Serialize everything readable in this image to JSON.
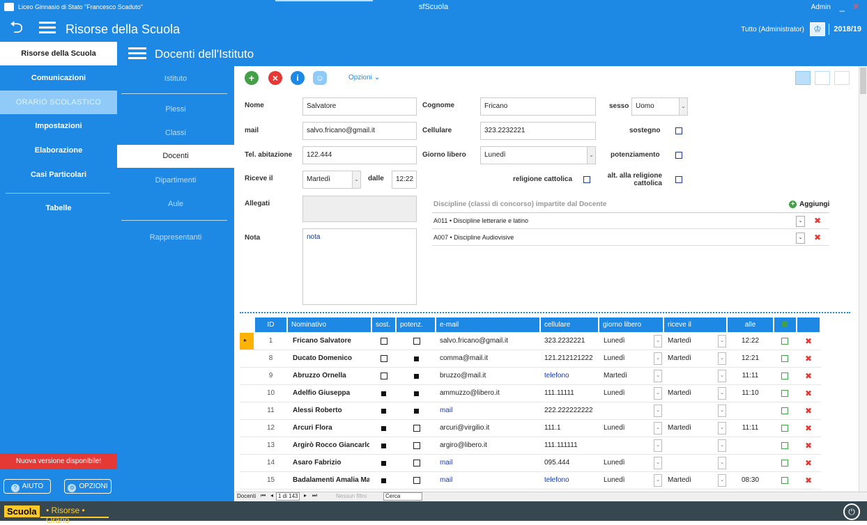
{
  "window": {
    "school": "Liceo Ginnasio di Stato \"Francesco Scaduto\"",
    "app_title": "sfScuola",
    "user": "Admin"
  },
  "header": {
    "title": "Risorse della Scuola",
    "user_label": "Tutto (Administrator)",
    "year": "2018/19"
  },
  "sidebar": {
    "items": [
      "Risorse della Scuola",
      "Comunicazioni",
      "ORARIO SCOLASTICO",
      "Impostazioni",
      "Elaborazione",
      "Casi Particolari",
      "Tabelle"
    ],
    "new_version": "Nuova versione disponibile!",
    "help": "AIUTO",
    "options": "OPZIONI"
  },
  "bottom": {
    "brand": "Scuola",
    "sub": "• Risorse • Orario"
  },
  "panel": {
    "title": "Docenti dell'Istituto"
  },
  "subnav": [
    "Istituto",
    "Plessi",
    "Classi",
    "Docenti",
    "Dipartimenti",
    "Aule",
    "Rappresentanti"
  ],
  "toolbar": {
    "options": "Opzioni"
  },
  "form": {
    "labels": {
      "nome": "Nome",
      "cognome": "Cognome",
      "sesso": "sesso",
      "mail": "mail",
      "cellulare": "Cellulare",
      "sostegno": "sostegno",
      "tel": "Tel. abitazione",
      "giorno": "Giorno libero",
      "potenziamento": "potenziamento",
      "riceve": "Riceve il",
      "dalle": "dalle",
      "religione": "religione cattolica",
      "alt1": "alt. alla religione",
      "alt2": "cattolica",
      "allegati": "Allegati",
      "nota": "Nota"
    },
    "values": {
      "nome": "Salvatore",
      "cognome": "Fricano",
      "sesso": "Uomo",
      "mail": "salvo.fricano@gmail.it",
      "cellulare": "323.2232221",
      "tel": "122.444",
      "giorno": "Lunedì",
      "riceve": "Martedì",
      "dalle": "12:22",
      "nota": "nota"
    },
    "disciplines_title": "Discipline (classi di concorso) impartite dal Docente",
    "add": "Aggiungi",
    "disciplines": [
      "A011 • Discipline letterarie e latino",
      "A007 • Discipline Audiovisive"
    ]
  },
  "table": {
    "headers": [
      "ID",
      "Nominativo",
      "sost.",
      "potenz.",
      "e-mail",
      "cellulare",
      "giorno libero",
      "riceve il",
      "alle"
    ],
    "rows": [
      {
        "id": "1",
        "name": "Fricano Salvatore",
        "sost": false,
        "pot": false,
        "email": "salvo.fricano@gmail.it",
        "cell": "323.2232221",
        "giorno": "Lunedì",
        "riceve": "Martedì",
        "alle": "12:22"
      },
      {
        "id": "8",
        "name": "Ducato Domenico",
        "sost": false,
        "pot": true,
        "email": "comma@mail.it",
        "cell": "121.212121222",
        "giorno": "Lunedì",
        "riceve": "Martedì",
        "alle": "12:21"
      },
      {
        "id": "9",
        "name": "Abruzzo Ornella",
        "sost": false,
        "pot": true,
        "email": "bruzzo@mail.it",
        "cell": "telefono",
        "giorno": "Martedì",
        "riceve": "",
        "alle": "11:11"
      },
      {
        "id": "10",
        "name": "Adelfio Giuseppa",
        "sost": true,
        "pot": true,
        "email": "ammuzzo@libero.it",
        "cell": "111.11111",
        "giorno": "Lunedì",
        "riceve": "Martedì",
        "alle": "11:10"
      },
      {
        "id": "11",
        "name": "Alessi Roberto",
        "sost": true,
        "pot": true,
        "email": "mail",
        "cell": "222.222222222",
        "giorno": "",
        "riceve": "",
        "alle": ""
      },
      {
        "id": "12",
        "name": "Arcuri Flora",
        "sost": true,
        "pot": false,
        "email": "arcuri@virgilio.it",
        "cell": "111.1",
        "giorno": "Lunedì",
        "riceve": "Martedì",
        "alle": "11:11"
      },
      {
        "id": "13",
        "name": "Argirò Rocco Giancarlo",
        "sost": true,
        "pot": false,
        "email": "argiro@libero.it",
        "cell": "111.111111",
        "giorno": "",
        "riceve": "",
        "alle": ""
      },
      {
        "id": "14",
        "name": "Asaro Fabrizio",
        "sost": true,
        "pot": false,
        "email": "mail",
        "cell": "095.444",
        "giorno": "Lunedì",
        "riceve": "",
        "alle": ""
      },
      {
        "id": "15",
        "name": "Badalamenti Amalia Ma",
        "sost": true,
        "pot": false,
        "email": "mail",
        "cell": "telefono",
        "giorno": "Lunedì",
        "riceve": "Martedì",
        "alle": "08:30"
      }
    ]
  },
  "navigator": {
    "label": "Docenti",
    "position": "1 di 143",
    "filter": "Nessun filtro",
    "search": "Cerca"
  }
}
